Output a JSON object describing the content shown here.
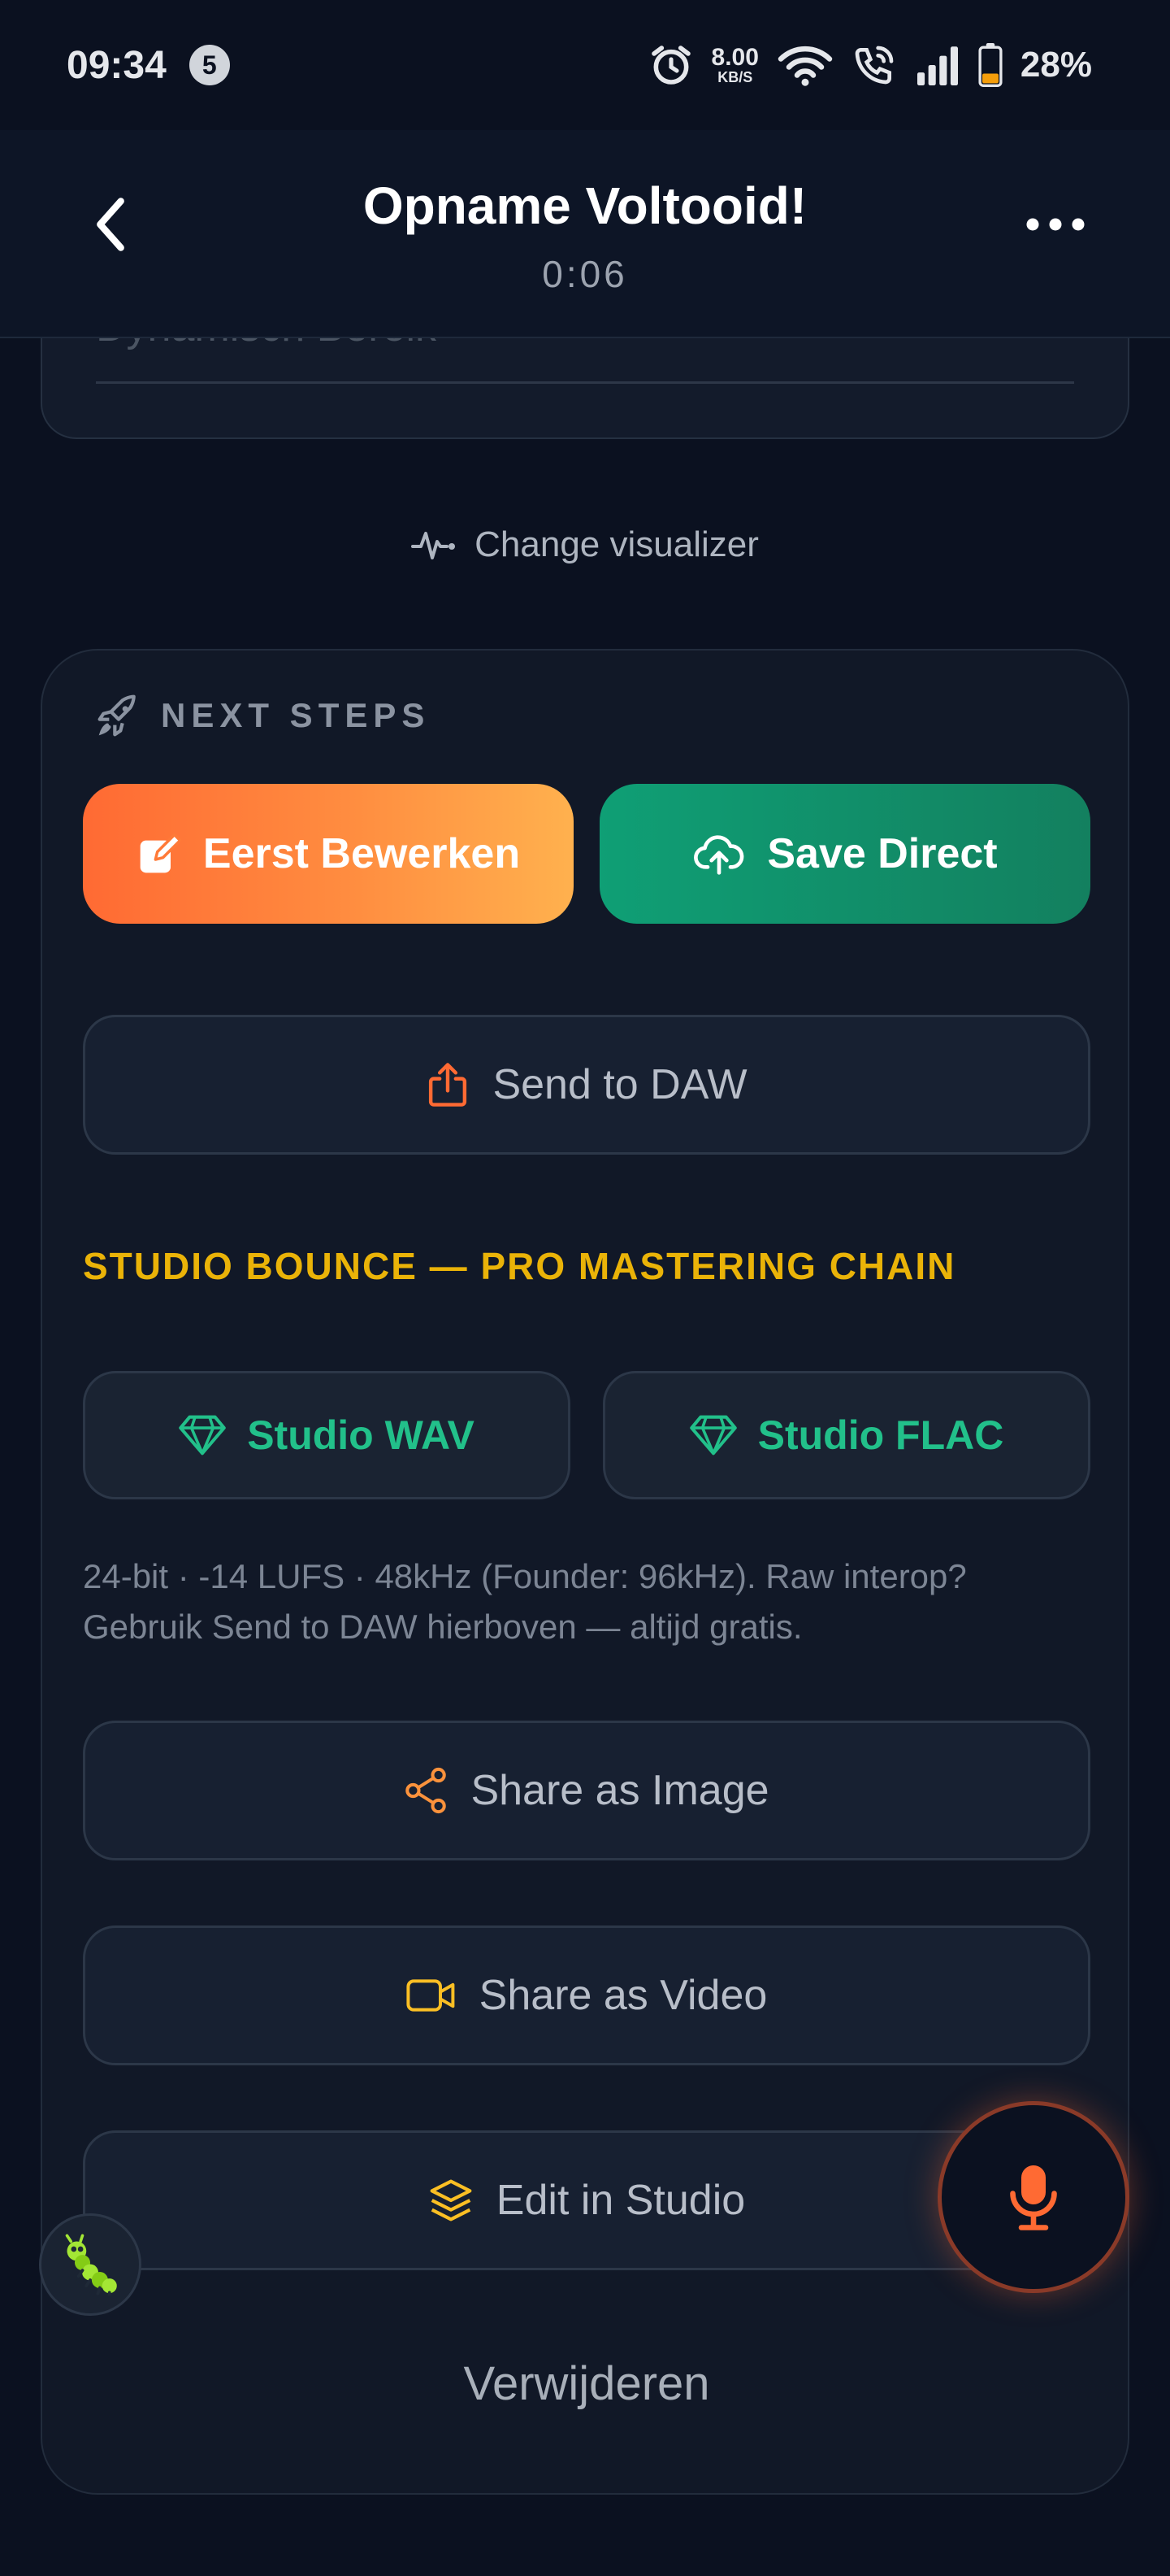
{
  "status_bar": {
    "time": "09:34",
    "notification_count": "5",
    "net_speed_value": "8.00",
    "net_speed_unit": "KB/S",
    "battery_percent": "28%",
    "battery_level": 0.28
  },
  "header": {
    "title": "Opname Voltooid!",
    "duration": "0:06"
  },
  "prev_card": {
    "label": "Dynamisch Bereik"
  },
  "visualizer": {
    "label": "Change visualizer"
  },
  "next_steps": {
    "heading": "NEXT STEPS",
    "edit_first_label": "Eerst Bewerken",
    "save_direct_label": "Save Direct",
    "send_to_daw_label": "Send to DAW",
    "studio_bounce_heading": "STUDIO BOUNCE — PRO MASTERING CHAIN",
    "studio_wav_label": "Studio WAV",
    "studio_flac_label": "Studio FLAC",
    "studio_note_line1": "24-bit · -14 LUFS · 48kHz (Founder: 96kHz). Raw interop?",
    "studio_note_line2": "Gebruik Send to DAW hierboven — altijd gratis.",
    "share_image_label": "Share as Image",
    "share_video_label": "Share as Video",
    "edit_studio_label": "Edit in Studio",
    "delete_label": "Verwijderen"
  },
  "colors": {
    "background": "#0b1120",
    "accent_orange": "#ff6a33",
    "accent_green": "#13805f",
    "gem_green": "#22c08a",
    "heading_yellow": "#eab308"
  },
  "icons": {
    "edit": "edit-square-icon",
    "save": "cloud-upload-icon",
    "daw": "share-upload-icon",
    "gem": "diamond-icon",
    "image": "share-nodes-icon",
    "video": "video-camera-icon",
    "studio": "layers-icon",
    "mic": "microphone-icon",
    "bug": "bug-icon"
  }
}
